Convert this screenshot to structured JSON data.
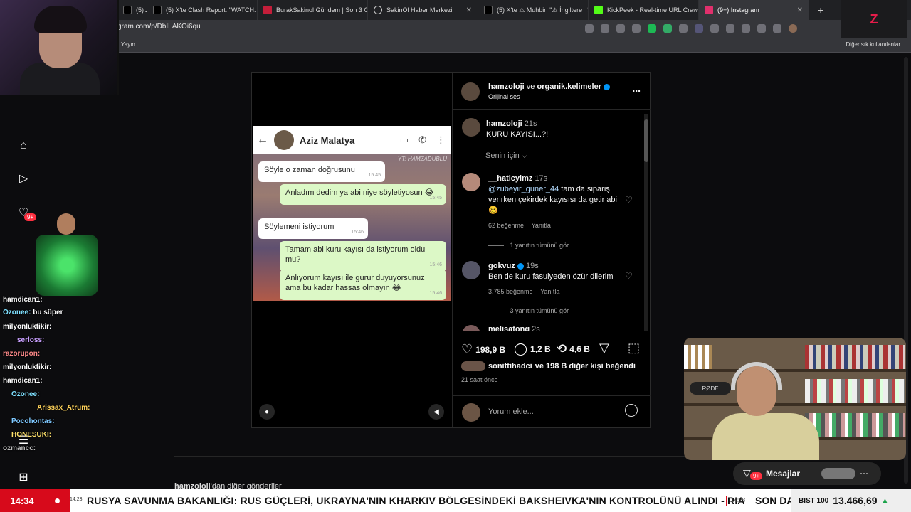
{
  "browser": {
    "tabs": [
      {
        "label": "(5) شـ",
        "color": "#1da1f2"
      },
      {
        "label": "(5) X'te Clash Report: \"WATCH: Ru",
        "color": "#ffffff"
      },
      {
        "label": "BurakSakinol Gündem | Son 3 Gü",
        "color": "#c41e3a"
      },
      {
        "label": "SakinOl Haber Merkezi",
        "color": "#888888"
      },
      {
        "label": "(5) X'te ⚠ Muhbir: \"⚠ İngiltere",
        "color": "#ffffff"
      },
      {
        "label": "KickPeek - Real-time URL Crawler",
        "color": "#53fc18"
      },
      {
        "label": "(9+) Instagram",
        "color": "#e1306c"
      }
    ],
    "url": "gram.com/p/DbILAKOi6qu",
    "bookmark_left": "Yayın",
    "bookmark_right": "Diğer sık kullanılanlar"
  },
  "post": {
    "header": {
      "user1": "hamzoloji",
      "connector": "ve",
      "user2": "organik.kelimeler",
      "subtitle": "Orijinal ses",
      "more": "..."
    },
    "chat": {
      "contact": "Aziz Malatya",
      "watermark": "YT: HAMZADUBLU",
      "messages": [
        {
          "text": "Söyle o zaman doğrusunu",
          "time": "15:45",
          "dir": "in"
        },
        {
          "text": "Anladım dedim ya abi niye söyletiyosun 😂",
          "time": "15:45",
          "dir": "out"
        },
        {
          "text": "Söylemeni istiyorum",
          "time": "15:46",
          "dir": "in"
        },
        {
          "text": "Tamam abi kuru kayısı da istiyorum oldu mu?",
          "time": "15:46",
          "dir": "out"
        },
        {
          "text": "Anlıyorum kayısı ile gurur duyuyorsunuz ama bu kadar hassas olmayın 😂",
          "time": "15:46",
          "dir": "out"
        }
      ]
    },
    "caption": {
      "user": "hamzoloji",
      "time": "21s",
      "text": "KURU KAYISI...?!"
    },
    "for_you": "Senin için",
    "comments": [
      {
        "user": "__haticylmz",
        "time": "17s",
        "mention": "@zubeyir_guner_44",
        "text": "tam da sipariş verirken çekirdek kayısısı da getir abi 🥴",
        "likes": "62 beğenme",
        "reply": "Yanıtla",
        "view_replies": "1 yanıtın tümünü gör"
      },
      {
        "user": "gokvuz",
        "time": "19s",
        "text": "Ben de kuru fasulyeden özür dilerim",
        "likes": "3.785 beğenme",
        "reply": "Yanıtla",
        "view_replies": "3 yanıtın tümünü gör"
      },
      {
        "user": "melisatong",
        "time": "2s"
      }
    ],
    "stats": {
      "likes": "198,9 B",
      "comments": "1,2 B",
      "reposts": "4,6 B"
    },
    "liked_by": {
      "user": "sonittihadci",
      "rest": "ve 198 B diğer kişi beğendi"
    },
    "posted": "21 saat önce",
    "comment_placeholder": "Yorum ekle...",
    "more_posts_user": "hamzoloji",
    "more_posts_text": "'dan diğer gönderiler"
  },
  "overlay_chat": [
    {
      "user": "hamdican1:",
      "msg": ""
    },
    {
      "user": "Ozonee:",
      "msg": "bu süper"
    },
    {
      "user": "milyonlukfikir:",
      "msg": ""
    },
    {
      "user": "serloss:",
      "msg": ""
    },
    {
      "user": "razorupon:",
      "msg": ""
    },
    {
      "user": "milyonlukfikir:",
      "msg": ""
    },
    {
      "user": "hamdican1:",
      "msg": ""
    },
    {
      "user": "Ozonee:",
      "msg": ""
    },
    {
      "user": "Arissax_Atrum:",
      "msg": ""
    },
    {
      "user": "Pocohontas:",
      "msg": ""
    },
    {
      "user": "HONESUKI:",
      "msg": ""
    },
    {
      "user": "ozmancc:",
      "msg": ""
    }
  ],
  "notif_badge": "9+",
  "messages_label": "Mesajlar",
  "messages_badge": "9+",
  "cam_mic_label": "RØDE",
  "ticker": {
    "clock": "14:34",
    "live_time": "14:23",
    "headline": "RUSYA SAVUNMA BAKANLIĞI: RUS GÜÇLERİ, UKRAYNA'NIN KHARKIV BÖLGESİNDEKİ BAKSHEIVKA'NIN KONTROLÜNÜ ALINDI - RIA",
    "next_time": "14:23",
    "next": "SON DA",
    "bist_label": "BIST 100",
    "bist_value": "13.466,69"
  },
  "brand_logo": "Z"
}
